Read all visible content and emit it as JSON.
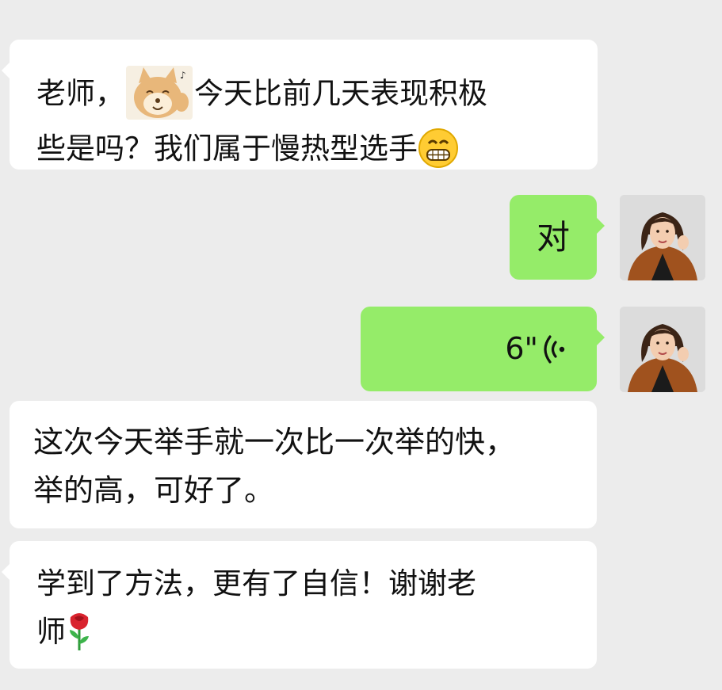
{
  "messages": [
    {
      "direction": "incoming",
      "line1_a": "老师，",
      "line1_b": "今天比前几天表现积极",
      "line2": "些是吗？我们属于慢热型选手",
      "sticker": "shiba-dog-sticker",
      "emoji": "grinning-face-emoji"
    },
    {
      "direction": "outgoing",
      "text": "对"
    },
    {
      "direction": "outgoing",
      "type": "voice",
      "duration": "6\""
    },
    {
      "direction": "incoming",
      "line1": "这次今天举手就一次比一次举的快，",
      "line2": "举的高，可好了。"
    },
    {
      "direction": "incoming",
      "line1": "学到了方法，更有了自信！谢谢老",
      "line2": "师",
      "emoji": "rose-emoji"
    }
  ],
  "colors": {
    "background": "#ececec",
    "incoming_bubble": "#ffffff",
    "outgoing_bubble": "#95ec69",
    "text": "#111111"
  }
}
